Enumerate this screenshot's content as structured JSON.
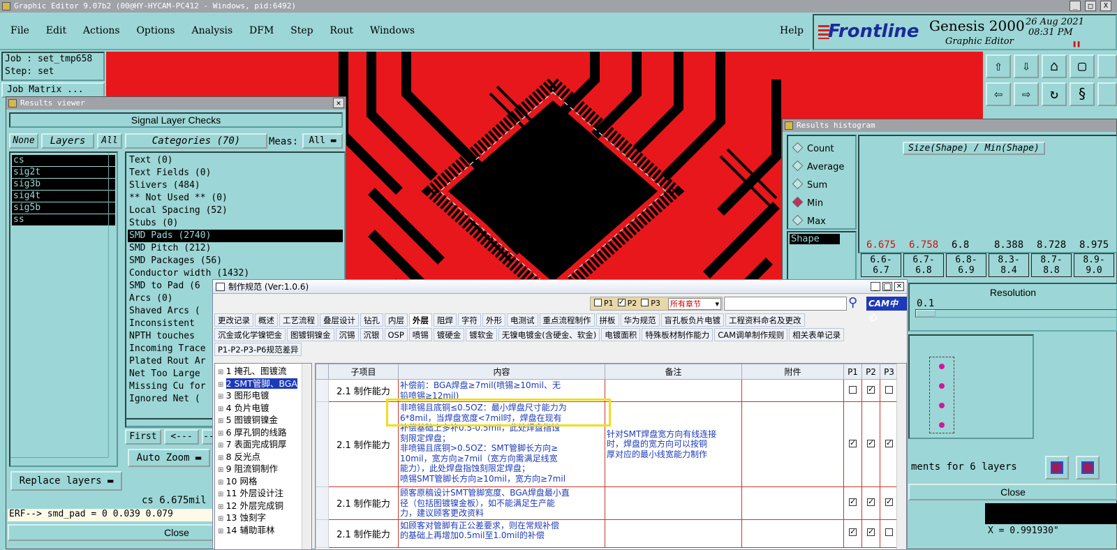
{
  "window": {
    "title": "Graphic Editor 9.07b2 (00@HY-HYCAM-PC412 - Windows, pid:6492)",
    "controls": [
      "_",
      "□",
      "X"
    ]
  },
  "menu": [
    "File",
    "Edit",
    "Actions",
    "Options",
    "Analysis",
    "DFM",
    "Step",
    "Rout",
    "Windows"
  ],
  "help": "Help",
  "brand": {
    "logo": "Frontline",
    "product": "Genesis 2000",
    "date": "26 Aug 2021",
    "time": "08:31 PM",
    "subtitle": "Graphic Editor"
  },
  "job": {
    "job_label": "Job : set_tmp658",
    "step_label": "Step: set",
    "matrix": "Job Matrix ..."
  },
  "results_viewer": {
    "title": "Results viewer",
    "header": "Signal Layer Checks",
    "none_btn": "None",
    "layers_btn": "Layers",
    "all_btn": "All",
    "layers": [
      "cs",
      "sig2t",
      "sig3b",
      "sig4t",
      "sig5b",
      "ss"
    ],
    "categories_btn": "Categories (70)",
    "meas_label": "Meas:",
    "meas_value": "All",
    "categories": [
      "Text (0)",
      "Text Fields (0)",
      "Slivers (484)",
      "** Not Used ** (0)",
      "Local Spacing (52)",
      "Stubs (0)",
      "SMD Pads (2740)",
      "SMD Pitch (212)",
      "SMD Packages (56)",
      "Conductor width (1432)",
      "SMD to Pad (6",
      "Arcs (0)",
      "Shaved Arcs (",
      "Inconsistent ",
      "NPTH touches ",
      "Incoming Trace",
      "Plated Rout Ar",
      "Net Too Large ",
      "Missing Cu for",
      "Ignored Net ("
    ],
    "selected_category_index": 6,
    "first_btn": "First",
    "prev_btn": "<---",
    "more_btn": "--",
    "auto_zoom": "Auto Zoom",
    "replace_layers": "Replace layers",
    "status": "cs 6.675mil",
    "erf": "ERF--> smd_pad = 0 0.039 0.079",
    "close": "Close"
  },
  "histogram": {
    "title": "Results histogram",
    "options": [
      "Count",
      "Average",
      "Sum",
      "Min",
      "Max"
    ],
    "selected": "Min",
    "shape_label": "Shape",
    "chart_title": "Size(Shape) / Min(Shape)",
    "values": [
      "6.675",
      "6.758",
      "6.8",
      "8.388",
      "8.728",
      "8.975"
    ],
    "value_colors": [
      "#d01010",
      "#d01010",
      "#000",
      "#000",
      "#000",
      "#000"
    ],
    "bins": [
      [
        "6.6-",
        "6.7"
      ],
      [
        "6.7-",
        "6.8"
      ],
      [
        "6.8-",
        "6.9"
      ],
      [
        "8.3-",
        "8.4"
      ],
      [
        "8.7-",
        "8.8"
      ],
      [
        "8.9-",
        "9.0"
      ]
    ],
    "resolution_label": "Resolution",
    "resolution_value": "0.1",
    "footer": "ments for 6 layers",
    "close": "Close",
    "coord": "X = 0.991930\""
  },
  "spec": {
    "title": "制作规范 (Ver:1.0.6)",
    "checks": [
      "P1",
      "P2",
      "P3"
    ],
    "checks_state": [
      false,
      true,
      false
    ],
    "chapter_select": "所有章节",
    "search_placeholder": "",
    "logo": "CAM中心",
    "tabs_row1": [
      "更改记录",
      "概述",
      "工艺流程",
      "叠层设计",
      "钻孔",
      "内层",
      "外层",
      "阻焊",
      "字符",
      "外形",
      "电测试",
      "重点流程制作",
      "拼板",
      "华为规范",
      "盲孔板负片电镀",
      "工程资料命名及更改"
    ],
    "active_tab": "外层",
    "tabs_row2": [
      "沉金或化学镍钯金",
      "图镀铜镍金",
      "沉锡",
      "沉银",
      "OSP",
      "喷锡",
      "镀硬金",
      "镀软金",
      "无镍电镀金(含硬金、软金)",
      "电镀面积",
      "特殊板材制作能力",
      "CAM调单制作规则",
      "相关表单记录"
    ],
    "tabs_row3": [
      "P1-P2-P3-P6规范差异"
    ],
    "tree": [
      "1 掩孔、图镀流",
      "2 SMT管脚、BGA",
      "3 图形电镀",
      "4 负片电镀",
      "5 图镀铜镍金",
      "6 厚孔铜的线路",
      "7 表面完成铜厚",
      "8 反光点",
      "9 阻流铜制作",
      "10 网格",
      "11 外层设计注",
      "12 外层完成铜",
      "13 蚀刻字",
      "14 辅助菲林"
    ],
    "tree_selected": 1,
    "columns": [
      "子项目",
      "内容",
      "备注",
      "附件",
      "P1",
      "P2",
      "P3"
    ],
    "rows": [
      {
        "sub": "2.1 制作能力",
        "content": [
          "补偿前：BGA焊盘≥7mil(喷锡≥10mil、无",
          "铅喷锡≥12mil)"
        ],
        "note": [],
        "p": [
          false,
          true,
          false
        ]
      },
      {
        "sub": "2.1 制作能力",
        "content": [
          "非喷锡且底铜≤0.5OZ：最小焊盘尺寸能力为",
          "6*8mil，当焊盘宽度<7mil时，焊盘在现有",
          "补偿基础上多补0.5-0.5mil，此处焊盘指蚀",
          "刻限定焊盘；",
          "非喷锡且底铜>0.5OZ：SMT管脚长方向≥",
          "10mil，宽方向≥7mil（宽方向需满足线宽",
          "能力），此处焊盘指蚀刻限定焊盘；",
          "喷锡SMT管脚长方向≥10mil，宽方向≥7mil"
        ],
        "note": [
          "针对SMT焊盘宽方向有线连接",
          "时，焊盘的宽方向可以按铜",
          "厚对应的最小线宽能力制作"
        ],
        "p": [
          true,
          true,
          true
        ]
      },
      {
        "sub": "2.1 制作能力",
        "content": [
          "顾客原稿设计SMT管脚宽度、BGA焊盘最小直",
          "径（包括图镀镍金板），如不能满足生产能",
          "力，建议顾客更改资料"
        ],
        "note": [],
        "p": [
          true,
          true,
          true
        ]
      },
      {
        "sub": "2.1 制作能力",
        "content": [
          "如顾客对管脚有正公差要求，则在常规补偿",
          "的基础上再增加0.5mil至1.0mil的补偿"
        ],
        "note": [],
        "p": [
          true,
          true,
          false
        ]
      }
    ]
  }
}
